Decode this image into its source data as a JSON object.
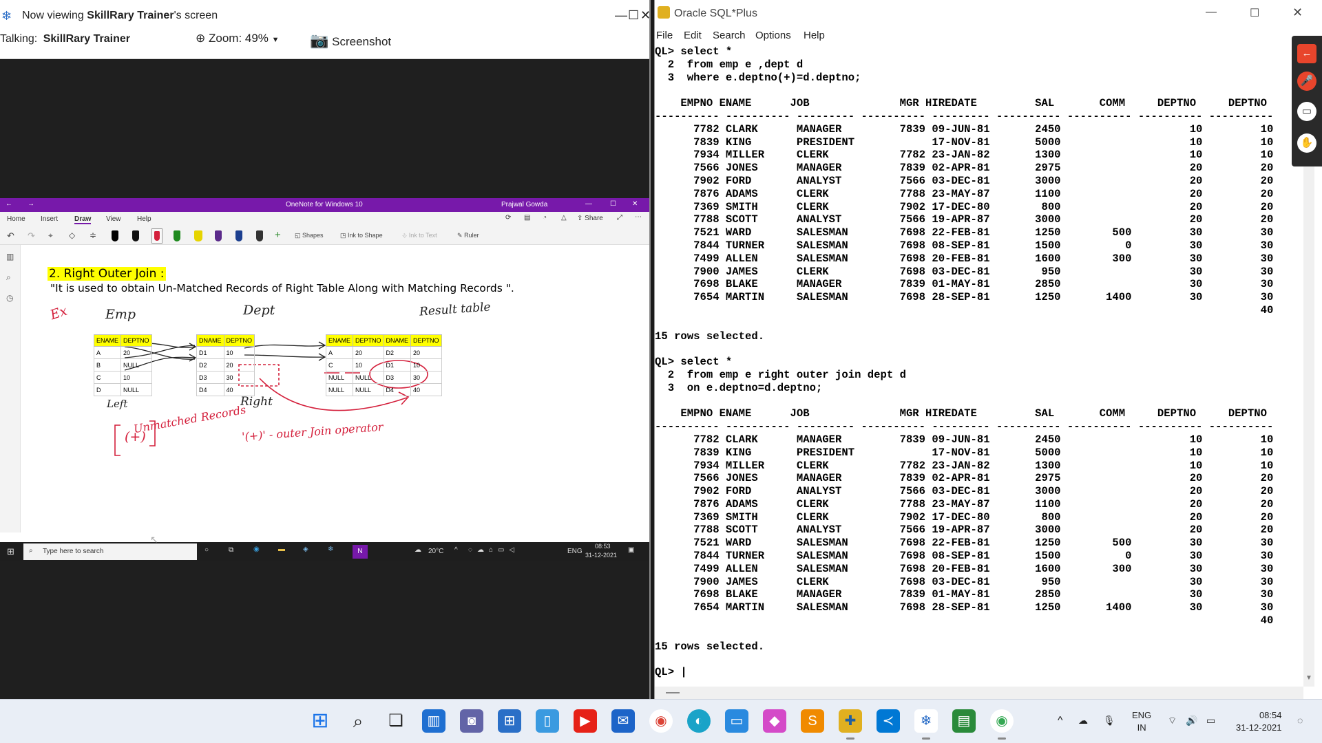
{
  "viewer": {
    "title_prefix": "Now viewing",
    "title_name": "SkillRary Trainer",
    "title_suffix": "'s screen",
    "talking_label": "Talking:",
    "talking_name": "SkillRary Trainer",
    "zoom_label": "Zoom: 49%",
    "screenshot_label": "Screenshot"
  },
  "onenote": {
    "app_title": "OneNote for Windows 10",
    "user": "Prajwal Gowda",
    "tabs": [
      "Home",
      "Insert",
      "Draw",
      "View",
      "Help"
    ],
    "active_tab": "Draw",
    "share_label": "Share",
    "ribbon_tools": [
      "Shapes",
      "Ink to Shape",
      "Ink to Text",
      "Ruler"
    ],
    "heading": "2. Right Outer Join :",
    "definition": "\"It is used to obtain Un-Matched Records of Right Table Along with Matching Records \".",
    "ink_notes": {
      "ex": "Ex",
      "emp": "Emp",
      "dept": "Dept",
      "result": "Result table",
      "left": "Left",
      "right": "Right",
      "unmatched": "Unmatched Records",
      "operator_symbol": "(+)",
      "operator_desc": "'(+)' - outer Join operator"
    },
    "emp_table": {
      "headers": [
        "ENAME",
        "DEPTNO"
      ],
      "rows": [
        [
          "A",
          "20"
        ],
        [
          "B",
          "NULL"
        ],
        [
          "C",
          "10"
        ],
        [
          "D",
          "NULL"
        ]
      ]
    },
    "dept_table": {
      "headers": [
        "DNAME",
        "DEPTNO"
      ],
      "rows": [
        [
          "D1",
          "10"
        ],
        [
          "D2",
          "20"
        ],
        [
          "D3",
          "30"
        ],
        [
          "D4",
          "40"
        ]
      ]
    },
    "result_table": {
      "headers": [
        "ENAME",
        "DEPTNO",
        "DNAME",
        "DEPTNO"
      ],
      "rows": [
        [
          "A",
          "20",
          "D2",
          "20"
        ],
        [
          "C",
          "10",
          "D1",
          "10"
        ],
        [
          "NULL",
          "NULL",
          "D3",
          "30"
        ],
        [
          "NULL",
          "NULL",
          "D4",
          "40"
        ]
      ]
    },
    "taskbar": {
      "search_placeholder": "Type here to search",
      "weather": "20°C",
      "lang": "ENG",
      "time": "08:53",
      "date": "31-12-2021"
    }
  },
  "sqlplus": {
    "title": "Oracle SQL*Plus",
    "menu": [
      "File",
      "Edit",
      "Search",
      "Options",
      "Help"
    ],
    "lines": [
      "QL> select *",
      "  2  from emp e ,dept d",
      "  3  where e.deptno(+)=d.deptno;",
      "",
      "    EMPNO ENAME      JOB              MGR HIREDATE         SAL       COMM     DEPTNO     DEPTNO",
      "---------- ---------- --------- ---------- --------- ---------- ---------- ---------- ----------",
      "      7782 CLARK      MANAGER         7839 09-JUN-81       2450                    10         10",
      "      7839 KING       PRESIDENT            17-NOV-81       5000                    10         10",
      "      7934 MILLER     CLERK           7782 23-JAN-82       1300                    10         10",
      "      7566 JONES      MANAGER         7839 02-APR-81       2975                    20         20",
      "      7902 FORD       ANALYST         7566 03-DEC-81       3000                    20         20",
      "      7876 ADAMS      CLERK           7788 23-MAY-87       1100                    20         20",
      "      7369 SMITH      CLERK           7902 17-DEC-80        800                    20         20",
      "      7788 SCOTT      ANALYST         7566 19-APR-87       3000                    20         20",
      "      7521 WARD       SALESMAN        7698 22-FEB-81       1250        500         30         30",
      "      7844 TURNER     SALESMAN        7698 08-SEP-81       1500          0         30         30",
      "      7499 ALLEN      SALESMAN        7698 20-FEB-81       1600        300         30         30",
      "      7900 JAMES      CLERK           7698 03-DEC-81        950                    30         30",
      "      7698 BLAKE      MANAGER         7839 01-MAY-81       2850                    30         30",
      "      7654 MARTIN     SALESMAN        7698 28-SEP-81       1250       1400         30         30",
      "                                                                                              40",
      "",
      "15 rows selected.",
      "",
      "QL> select *",
      "  2  from emp e right outer join dept d",
      "  3  on e.deptno=d.deptno;",
      "",
      "    EMPNO ENAME      JOB              MGR HIREDATE         SAL       COMM     DEPTNO     DEPTNO",
      "---------- ---------- --------- ---------- --------- ---------- ---------- ---------- ----------",
      "      7782 CLARK      MANAGER         7839 09-JUN-81       2450                    10         10",
      "      7839 KING       PRESIDENT            17-NOV-81       5000                    10         10",
      "      7934 MILLER     CLERK           7782 23-JAN-82       1300                    10         10",
      "      7566 JONES      MANAGER         7839 02-APR-81       2975                    20         20",
      "      7902 FORD       ANALYST         7566 03-DEC-81       3000                    20         20",
      "      7876 ADAMS      CLERK           7788 23-MAY-87       1100                    20         20",
      "      7369 SMITH      CLERK           7902 17-DEC-80        800                    20         20",
      "      7788 SCOTT      ANALYST         7566 19-APR-87       3000                    20         20",
      "      7521 WARD       SALESMAN        7698 22-FEB-81       1250        500         30         30",
      "      7844 TURNER     SALESMAN        7698 08-SEP-81       1500          0         30         30",
      "      7499 ALLEN      SALESMAN        7698 20-FEB-81       1600        300         30         30",
      "      7900 JAMES      CLERK           7698 03-DEC-81        950                    30         30",
      "      7698 BLAKE      MANAGER         7839 01-MAY-81       2850                    30         30",
      "      7654 MARTIN     SALESMAN        7698 28-SEP-81       1250       1400         30         30",
      "                                                                                              40",
      "",
      "15 rows selected.",
      "",
      "QL> |"
    ]
  },
  "taskbar": {
    "lang_primary": "ENG",
    "lang_secondary": "IN",
    "time": "08:54",
    "date": "31-12-2021"
  },
  "colors": {
    "onenote_purple": "#7719aa",
    "ink_red": "#d4203c",
    "highlight_yellow": "#ffff00"
  }
}
